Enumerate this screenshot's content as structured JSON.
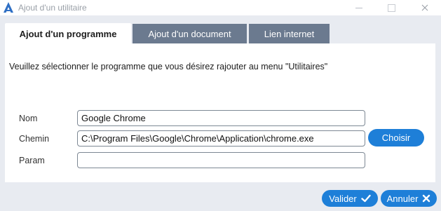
{
  "window": {
    "title": "Ajout d'un utilitaire",
    "icon": "app-logo-a-icon"
  },
  "tabs": [
    {
      "label": "Ajout d'un programme",
      "active": true
    },
    {
      "label": "Ajout d'un document",
      "active": false
    },
    {
      "label": "Lien internet",
      "active": false
    }
  ],
  "instruction": "Veuillez sélectionner le programme que vous désirez rajouter au menu \"Utilitaires\"",
  "form": {
    "nom": {
      "label": "Nom",
      "value": "Google Chrome"
    },
    "chemin": {
      "label": "Chemin",
      "value": "C:\\Program Files\\Google\\Chrome\\Application\\chrome.exe"
    },
    "param": {
      "label": "Param",
      "value": ""
    },
    "choisir_label": "Choisir"
  },
  "actions": {
    "valider_label": "Valider",
    "valider_icon": "check-icon",
    "annuler_label": "Annuler",
    "annuler_icon": "x-icon"
  },
  "colors": {
    "accent": "#1e7fd8",
    "tab_inactive": "#6b7a8f",
    "background": "#e8ebf1"
  }
}
